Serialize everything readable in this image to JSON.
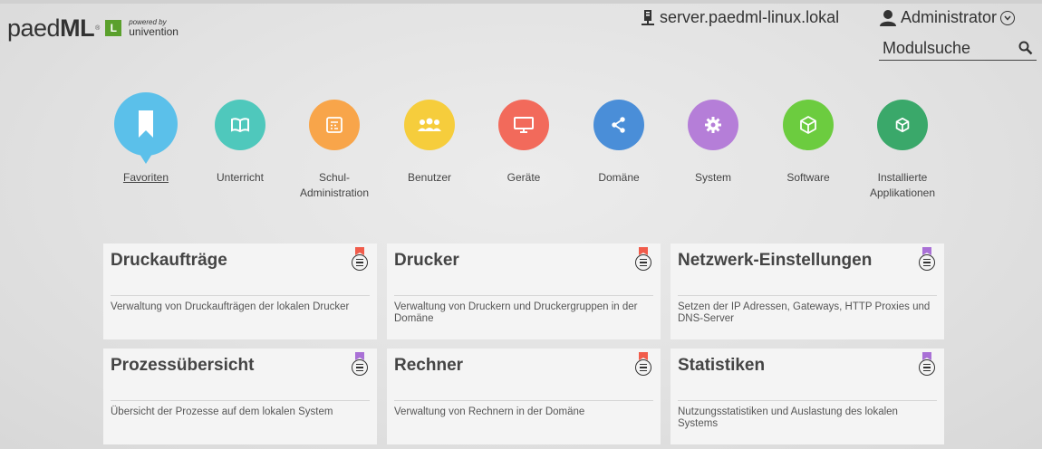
{
  "header": {
    "logo_text": "paed",
    "logo_text_bold": "ML",
    "logo_reg": "®",
    "logo_badge": "L",
    "powered_by": "powered by",
    "vendor": "univention",
    "server": "server.paedml-linux.lokal",
    "user": "Administrator",
    "search_placeholder": "Modulsuche"
  },
  "categories": [
    {
      "label": "Favoriten",
      "color": "#5bc0ea",
      "icon": "bookmark-icon"
    },
    {
      "label": "Unterricht",
      "color": "#4fc8bc",
      "icon": "book-icon"
    },
    {
      "label": "Schul-\nAdministration",
      "color": "#f8a54a",
      "icon": "calculator-icon"
    },
    {
      "label": "Benutzer",
      "color": "#f6cd3c",
      "icon": "users-icon"
    },
    {
      "label": "Geräte",
      "color": "#f26a5b",
      "icon": "monitor-icon"
    },
    {
      "label": "Domäne",
      "color": "#4a8ed8",
      "icon": "share-icon"
    },
    {
      "label": "System",
      "color": "#b57ed8",
      "icon": "gear-icon"
    },
    {
      "label": "Software",
      "color": "#6ccc3f",
      "icon": "cube-icon"
    },
    {
      "label": "Installierte\nApplikationen",
      "color": "#3aa86a",
      "icon": "box-icon"
    }
  ],
  "modules": [
    {
      "title": "Druckaufträge",
      "description": "Verwaltung von Druckaufträgen der lokalen Drucker",
      "bookmark_color": "#f15c4b"
    },
    {
      "title": "Drucker",
      "description": "Verwaltung von Druckern und Druckergruppen in der Domäne",
      "bookmark_color": "#f15c4b"
    },
    {
      "title": "Netzwerk-Einstellungen",
      "description": "Setzen der IP Adressen, Gateways, HTTP Proxies und DNS-Server",
      "bookmark_color": "#a970d6"
    },
    {
      "title": "Prozessübersicht",
      "description": "Übersicht der Prozesse auf dem lokalen System",
      "bookmark_color": "#a970d6"
    },
    {
      "title": "Rechner",
      "description": "Verwaltung von Rechnern in der Domäne",
      "bookmark_color": "#f15c4b"
    },
    {
      "title": "Statistiken",
      "description": "Nutzungsstatistiken und Auslastung des lokalen Systems",
      "bookmark_color": "#a970d6"
    }
  ]
}
